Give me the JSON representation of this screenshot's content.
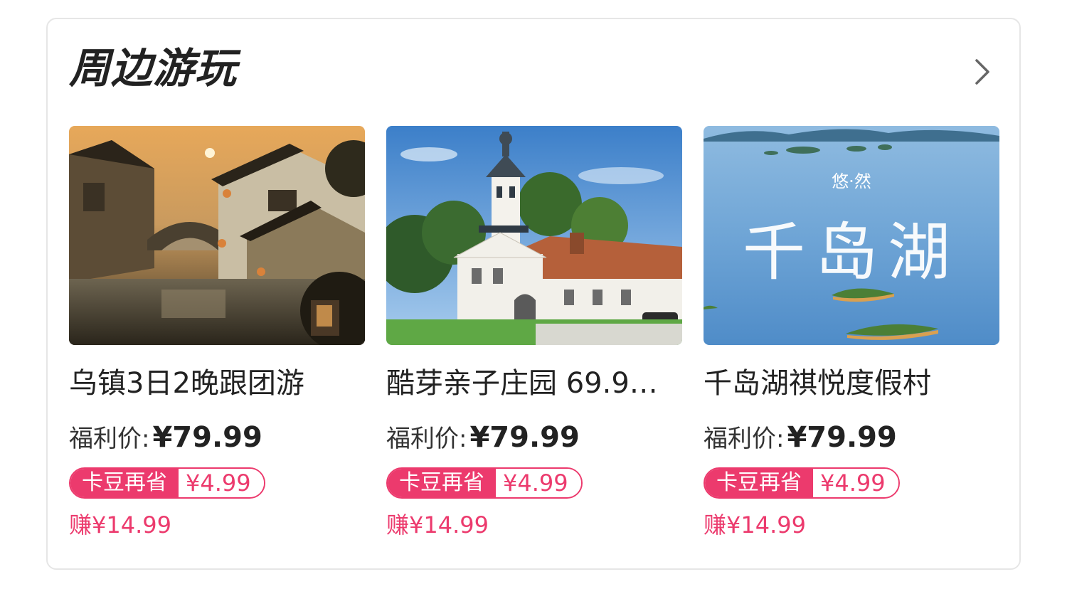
{
  "section": {
    "title": "周边游玩",
    "more_icon": "chevron-right-icon"
  },
  "colors": {
    "accent": "#ec3a6d",
    "title": "#222222",
    "border": "#e6e6e6"
  },
  "products": [
    {
      "name": "乌镇3日2晚跟团游",
      "price_label": "福利价:",
      "price": "¥79.99",
      "coupon_label": "卡豆再省",
      "coupon_value": "¥4.99",
      "earn": "赚¥14.99"
    },
    {
      "name": "酷芽亲子庄园 69.9…",
      "price_label": "福利价:",
      "price": "¥79.99",
      "coupon_label": "卡豆再省",
      "coupon_value": "¥4.99",
      "earn": "赚¥14.99"
    },
    {
      "name": "千岛湖祺悦度假村",
      "price_label": "福利价:",
      "price": "¥79.99",
      "coupon_label": "卡豆再省",
      "coupon_value": "¥4.99",
      "earn": "赚¥14.99",
      "image_caption_small": "悠·然",
      "image_caption_large": "千岛湖"
    }
  ]
}
